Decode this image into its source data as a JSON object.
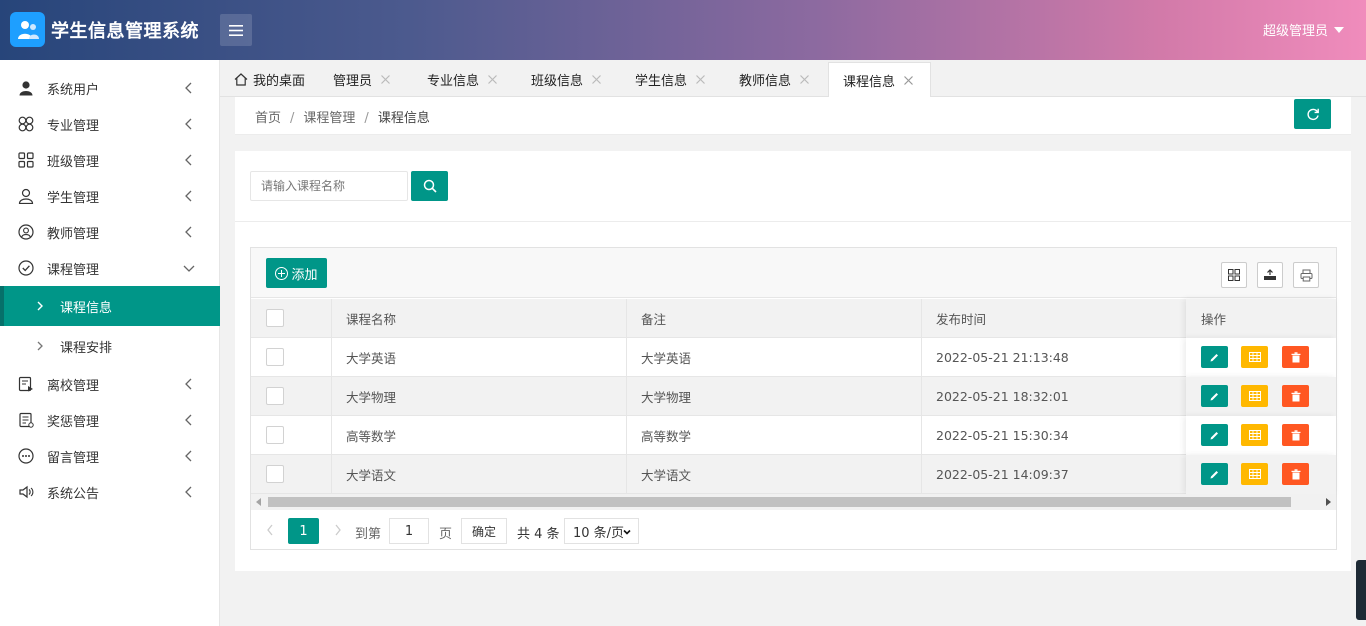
{
  "app": {
    "title": "学生信息管理系统"
  },
  "header": {
    "user_label": "超级管理员"
  },
  "sidebar": {
    "items": [
      {
        "label": "系统用户",
        "icon": "user-icon"
      },
      {
        "label": "专业管理",
        "icon": "clover-icon"
      },
      {
        "label": "班级管理",
        "icon": "grid-icon"
      },
      {
        "label": "学生管理",
        "icon": "person-icon"
      },
      {
        "label": "教师管理",
        "icon": "user-circle-icon"
      },
      {
        "label": "课程管理",
        "icon": "check-circle-icon",
        "expanded": true
      },
      {
        "label": "离校管理",
        "icon": "doc-icon"
      },
      {
        "label": "奖惩管理",
        "icon": "list-doc-icon"
      },
      {
        "label": "留言管理",
        "icon": "dial-icon"
      },
      {
        "label": "系统公告",
        "icon": "speaker-icon"
      }
    ],
    "sub_items": [
      {
        "label": "课程信息",
        "active": true
      },
      {
        "label": "课程安排",
        "active": false
      }
    ]
  },
  "tabs": [
    {
      "label": "我的桌面",
      "closable": false,
      "icon": "home-icon"
    },
    {
      "label": "管理员",
      "closable": true
    },
    {
      "label": "专业信息",
      "closable": true
    },
    {
      "label": "班级信息",
      "closable": true
    },
    {
      "label": "学生信息",
      "closable": true
    },
    {
      "label": "教师信息",
      "closable": true
    },
    {
      "label": "课程信息",
      "closable": true,
      "active": true
    }
  ],
  "breadcrumb": [
    "首页",
    "课程管理",
    "课程信息"
  ],
  "search": {
    "placeholder": "请输入课程名称",
    "value": ""
  },
  "toolbar": {
    "add_label": "添加"
  },
  "table": {
    "columns": [
      "课程名称",
      "备注",
      "发布时间",
      "操作"
    ],
    "rows": [
      {
        "name": "大学英语",
        "note": "大学英语",
        "time": "2022-05-21 21:13:48"
      },
      {
        "name": "大学物理",
        "note": "大学物理",
        "time": "2022-05-21 18:32:01"
      },
      {
        "name": "高等数学",
        "note": "高等数学",
        "time": "2022-05-21 15:30:34"
      },
      {
        "name": "大学语文",
        "note": "大学语文",
        "time": "2022-05-21 14:09:37"
      }
    ]
  },
  "pager": {
    "current_page": "1",
    "goto_label": "到第",
    "goto_value": "1",
    "page_unit": "页",
    "confirm_label": "确定",
    "total_label": "共 4 条",
    "page_size": "10 条/页"
  },
  "colors": {
    "primary": "#009688",
    "warn": "#ffb800",
    "danger": "#ff5722"
  }
}
